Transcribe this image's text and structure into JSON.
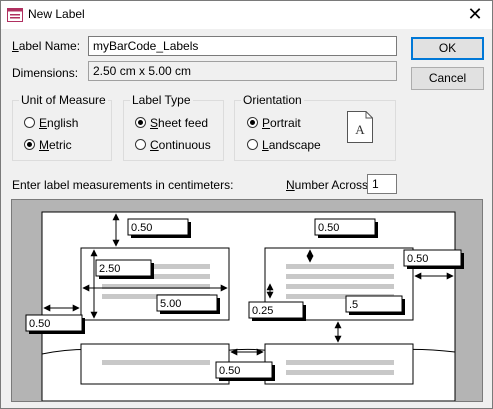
{
  "window": {
    "title": "New Label",
    "close_glyph": "✕"
  },
  "form": {
    "label_name_caption": "Label Name:",
    "label_name_underline": "L",
    "label_name_rest": "abel Name:",
    "label_name_value": "myBarCode_Labels",
    "dimensions_caption": "Dimensions:",
    "dimensions_value": "2.50 cm x 5.00 cm"
  },
  "buttons": {
    "ok": "OK",
    "cancel": "Cancel"
  },
  "unit_of_measure": {
    "title": "Unit of Measure",
    "english": {
      "u": "E",
      "rest": "nglish",
      "selected": false
    },
    "metric": {
      "u": "M",
      "rest": "etric",
      "selected": true
    }
  },
  "label_type": {
    "title": "Label Type",
    "sheet_feed": {
      "u": "S",
      "rest": "heet feed",
      "selected": true
    },
    "continuous": {
      "u": "C",
      "rest": "ontinuous",
      "selected": false
    }
  },
  "orientation": {
    "title": "Orientation",
    "portrait": {
      "u": "P",
      "rest": "ortrait",
      "selected": true
    },
    "landscape": {
      "u": "L",
      "rest": "andscape",
      "selected": false
    },
    "icon_letter": "A"
  },
  "measurements": {
    "instruction": "Enter label measurements in centimeters:",
    "number_across_u": "N",
    "number_across_rest": "umber Across:",
    "number_across_value": "1"
  },
  "preview": {
    "top_margin": "0.50",
    "top_margin_right": "0.50",
    "label_height": "2.50",
    "label_width": "5.00",
    "side_margin": "0.50",
    "right_margin": "0.50",
    "vertical_gap": "0.25",
    "corner_value": ".5",
    "horizontal_gap": "0.50"
  },
  "colors": {
    "accent": "#0078d7",
    "paper": "#ffffff",
    "backdrop": "#b4b4b4",
    "bars": "#c8c8c8"
  }
}
